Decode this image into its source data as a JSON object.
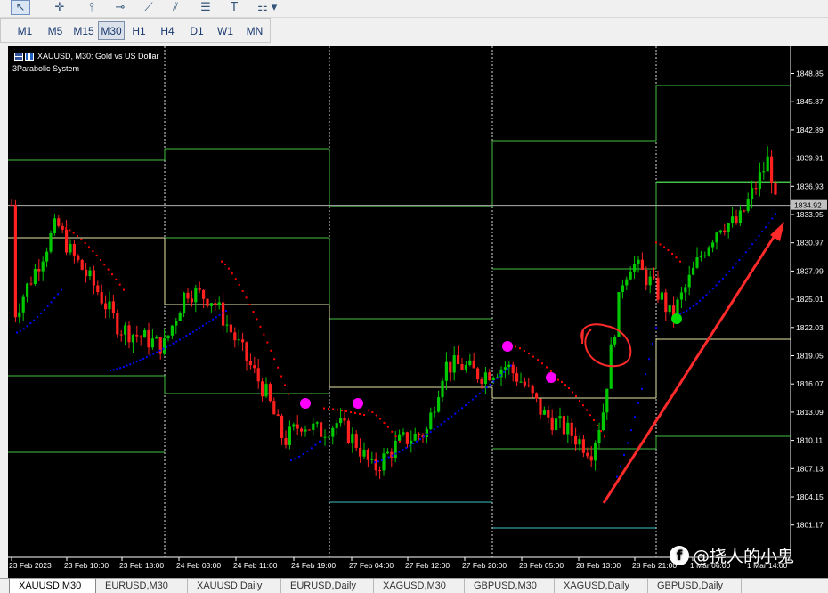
{
  "toolbar": {
    "tools": [
      {
        "name": "cursor-icon",
        "glyph": "↖"
      },
      {
        "name": "crosshair-icon",
        "glyph": "✛"
      },
      {
        "name": "vertical-line-icon",
        "glyph": "⫯"
      },
      {
        "name": "horizontal-line-icon",
        "glyph": "⊸"
      },
      {
        "name": "trendline-icon",
        "glyph": "⟋"
      },
      {
        "name": "channel-icon",
        "glyph": "⫽"
      },
      {
        "name": "fibonacci-icon",
        "glyph": "☰"
      },
      {
        "name": "text-tool-icon",
        "glyph": "T"
      },
      {
        "name": "shapes-icon",
        "glyph": "⚏"
      },
      {
        "name": "dropdown-icon",
        "glyph": "▾"
      }
    ]
  },
  "timeframes": [
    "M1",
    "M5",
    "M15",
    "M30",
    "H1",
    "H4",
    "D1",
    "W1",
    "MN"
  ],
  "active_timeframe": "M30",
  "chart": {
    "symbol_line": "XAUUSD, M30:  Gold vs US Dollar",
    "indicator": "3Parabolic System",
    "current_price": "1834.92",
    "price_labels": [
      "1848.85",
      "1845.87",
      "1842.89",
      "1839.91",
      "1836.93",
      "1833.95",
      "1830.97",
      "1827.99",
      "1825.01",
      "1822.03",
      "1819.05",
      "1816.07",
      "1813.09",
      "1810.11",
      "1807.13",
      "1804.15",
      "1801.17"
    ],
    "time_labels": [
      "23 Feb 2023",
      "23 Feb 10:00",
      "23 Feb 18:00",
      "24 Feb 03:00",
      "24 Feb 11:00",
      "24 Feb 19:00",
      "27 Feb 04:00",
      "27 Feb 12:00",
      "27 Feb 20:00",
      "28 Feb 05:00",
      "28 Feb 13:00",
      "28 Feb 21:00",
      "1 Mar 06:00",
      "1 Mar 14:00"
    ]
  },
  "tabs": [
    "XAUUSD,M30",
    "EURUSD,M30",
    "XAUUSD,Daily",
    "EURUSD,Daily",
    "XAGUSD,M30",
    "GBPUSD,M30",
    "XAGUSD,Daily",
    "GBPUSD,Daily"
  ],
  "watermark": "@挠人的小鬼",
  "colors": {
    "background": "#000000",
    "bull": "#00c800",
    "bear": "#ff2020",
    "sar_up": "#0000ff",
    "sar_down": "#ff0000",
    "annotation": "#ff2a2a",
    "magenta_dot": "#ff00ff",
    "green_dot": "#00dd00"
  }
}
